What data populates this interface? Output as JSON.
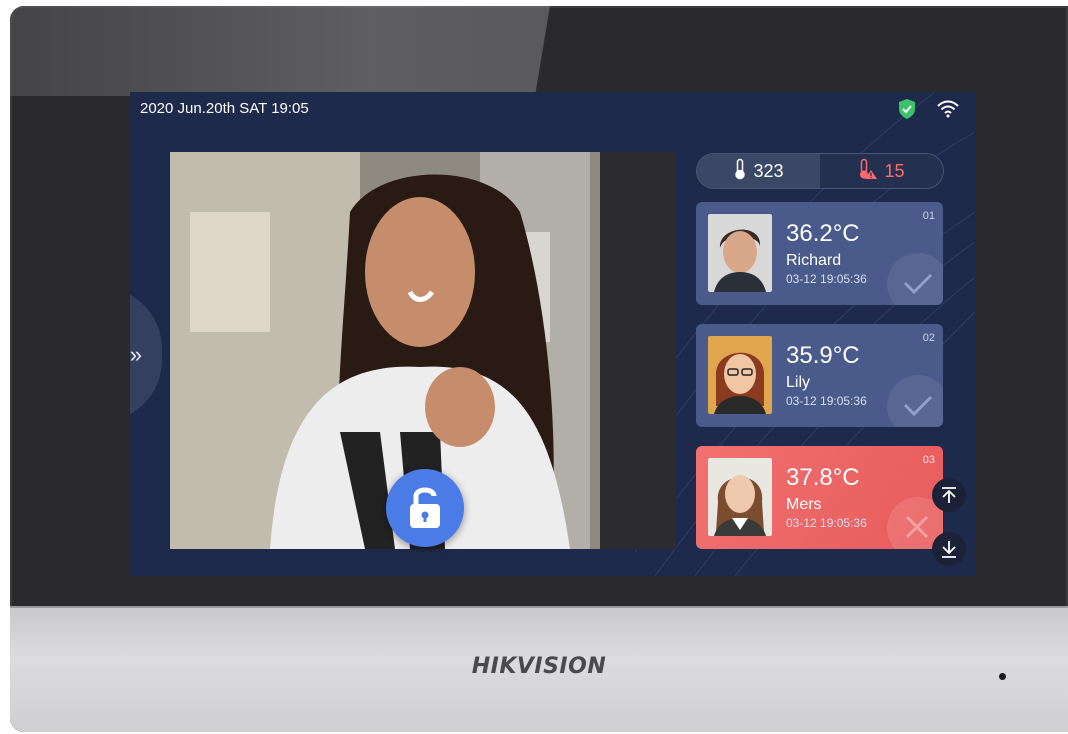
{
  "brand": "HIKVISION",
  "status_bar": {
    "datetime": "2020 Jun.20th  SAT  19:05",
    "icons": [
      "shield-check-icon",
      "wifi-icon"
    ]
  },
  "colors": {
    "screen_bg": "#1e2a4c",
    "card_normal": "#4a5a8a",
    "card_alert": "#e85b5b",
    "unlock_button": "#4a7be6",
    "alert_text": "#ff6a6a"
  },
  "counter": {
    "normal_count": "323",
    "abnormal_count": "15",
    "normal_icon": "thermometer-icon",
    "abnormal_icon": "thermometer-alert-icon"
  },
  "side_tab_label": "»",
  "records": [
    {
      "index": "01",
      "temperature": "36.2°C",
      "name": "Richard",
      "time": "03-12  19:05:36",
      "status": "check"
    },
    {
      "index": "02",
      "temperature": "35.9°C",
      "name": "Lily",
      "time": "03-12  19:05:36",
      "status": "check"
    },
    {
      "index": "03",
      "temperature": "37.8°C",
      "name": "Mers",
      "time": "03-12  19:05:36",
      "status": "cross"
    }
  ],
  "nav": {
    "top_icon": "scroll-top-icon",
    "down_icon": "scroll-down-icon"
  }
}
